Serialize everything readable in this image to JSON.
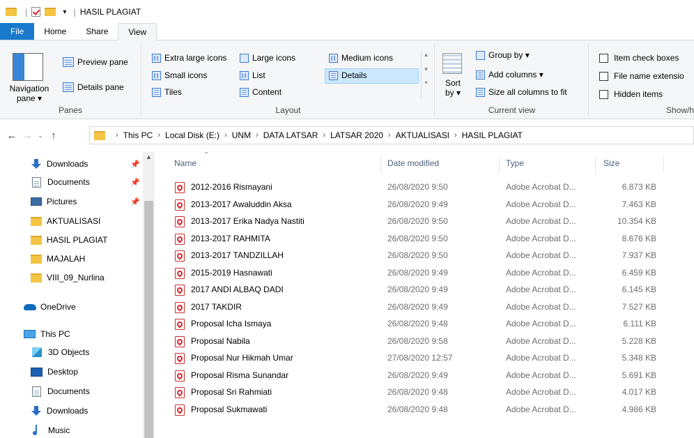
{
  "window": {
    "title": "HASIL PLAGIAT"
  },
  "ribbon_tabs": [
    "File",
    "Home",
    "Share",
    "View"
  ],
  "ribbon": {
    "panes": {
      "navigation_pane": "Navigation pane",
      "preview_pane": "Preview pane",
      "details_pane": "Details pane",
      "group_label": "Panes"
    },
    "layout": {
      "extra_large_icons": "Extra large icons",
      "large_icons": "Large icons",
      "medium_icons": "Medium icons",
      "small_icons": "Small icons",
      "list": "List",
      "details": "Details",
      "tiles": "Tiles",
      "content": "Content",
      "group_label": "Layout",
      "selected": "Details"
    },
    "current_view": {
      "sort_by": "Sort by",
      "group_by": "Group by",
      "add_columns": "Add columns",
      "size_all_columns": "Size all columns to fit",
      "group_label": "Current view"
    },
    "show_hide": {
      "item_check_boxes": "Item check boxes",
      "file_name_extensions": "File name extensio",
      "hidden_items": "Hidden items",
      "group_label": "Show/h"
    }
  },
  "address": {
    "breadcrumbs": [
      "This PC",
      "Local Disk (E:)",
      "UNM",
      "DATA LATSAR",
      "LATSAR 2020",
      "AKTUALISASI",
      "HASIL PLAGIAT"
    ]
  },
  "nav_pane": {
    "items": [
      {
        "label": "Downloads",
        "icon": "download-icon",
        "pinned": true
      },
      {
        "label": "Documents",
        "icon": "document-icon",
        "pinned": true
      },
      {
        "label": "Pictures",
        "icon": "pictures-icon",
        "pinned": true
      },
      {
        "label": "AKTUALISASI",
        "icon": "folder-icon",
        "pinned": false
      },
      {
        "label": "HASIL PLAGIAT",
        "icon": "folder-icon",
        "pinned": false
      },
      {
        "label": "MAJALAH",
        "icon": "folder-icon",
        "pinned": false
      },
      {
        "label": "VIII_09_Nurlina",
        "icon": "folder-icon",
        "pinned": false
      },
      {
        "label": "OneDrive",
        "icon": "onedrive-icon",
        "pinned": false
      },
      {
        "label": "This PC",
        "icon": "computer-icon",
        "pinned": false
      },
      {
        "label": "3D Objects",
        "icon": "3d-objects-icon",
        "pinned": false
      },
      {
        "label": "Desktop",
        "icon": "desktop-icon",
        "pinned": false
      },
      {
        "label": "Documents",
        "icon": "document-icon",
        "pinned": false
      },
      {
        "label": "Downloads",
        "icon": "download-icon",
        "pinned": false
      },
      {
        "label": "Music",
        "icon": "music-icon",
        "pinned": false
      }
    ]
  },
  "file_list": {
    "columns": [
      "Name",
      "Date modified",
      "Type",
      "Size"
    ],
    "rows": [
      {
        "name": "2012-2016 Rismayani",
        "date": "26/08/2020 9:50",
        "type": "Adobe Acrobat D...",
        "size": "6.873 KB"
      },
      {
        "name": "2013-2017 Awaluddin Aksa",
        "date": "26/08/2020 9:49",
        "type": "Adobe Acrobat D...",
        "size": "7.463 KB"
      },
      {
        "name": "2013-2017 Erika Nadya Nastiti",
        "date": "26/08/2020 9:50",
        "type": "Adobe Acrobat D...",
        "size": "10.354 KB"
      },
      {
        "name": "2013-2017 RAHMITA",
        "date": "26/08/2020 9:50",
        "type": "Adobe Acrobat D...",
        "size": "8.676 KB"
      },
      {
        "name": "2013-2017 TANDZILLAH",
        "date": "26/08/2020 9:50",
        "type": "Adobe Acrobat D...",
        "size": "7.937 KB"
      },
      {
        "name": "2015-2019 Hasnawati",
        "date": "26/08/2020 9:49",
        "type": "Adobe Acrobat D...",
        "size": "6.459 KB"
      },
      {
        "name": "2017 ANDI ALBAQ DADI",
        "date": "26/08/2020 9:49",
        "type": "Adobe Acrobat D...",
        "size": "6.145 KB"
      },
      {
        "name": "2017 TAKDIR",
        "date": "26/08/2020 9:49",
        "type": "Adobe Acrobat D...",
        "size": "7.527 KB"
      },
      {
        "name": "Proposal Icha Ismaya",
        "date": "26/08/2020 9:48",
        "type": "Adobe Acrobat D...",
        "size": "6.111 KB"
      },
      {
        "name": "Proposal Nabila",
        "date": "26/08/2020 9:58",
        "type": "Adobe Acrobat D...",
        "size": "5.228 KB"
      },
      {
        "name": "Proposal Nur Hikmah Umar",
        "date": "27/08/2020 12:57",
        "type": "Adobe Acrobat D...",
        "size": "5.348 KB"
      },
      {
        "name": "Proposal Risma Sunandar",
        "date": "26/08/2020 9:49",
        "type": "Adobe Acrobat D...",
        "size": "5.691 KB"
      },
      {
        "name": "Proposal Sri Rahmiati",
        "date": "26/08/2020 9:48",
        "type": "Adobe Acrobat D...",
        "size": "4.017 KB"
      },
      {
        "name": "Proposal Sukmawati",
        "date": "26/08/2020 9:48",
        "type": "Adobe Acrobat D...",
        "size": "4.986 KB"
      }
    ]
  },
  "colors": {
    "file_tab": "#1979ca",
    "selection": "#cce8ff",
    "folder": "#f4c542",
    "pdf": "#d9232e"
  }
}
